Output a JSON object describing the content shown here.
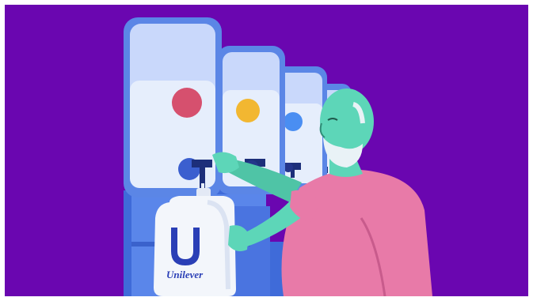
{
  "illustration": {
    "background_color": "#6a06b0",
    "dispenser_colors": {
      "frame": "#5b86e6",
      "tank_glass": "#c9d8fb",
      "liquid": "#e6eefc",
      "dots": [
        "#d6506e",
        "#f2b731",
        "#4a8ef2",
        "#4a8ef2"
      ]
    },
    "person_colors": {
      "skin": "#5dd6b8",
      "shirt": "#e87aa8",
      "beard": "#e9f2f6"
    },
    "bottle": {
      "color": "#f3f6fb",
      "logo_color": "#2a3fb6",
      "logo_text": "Unilever"
    }
  }
}
